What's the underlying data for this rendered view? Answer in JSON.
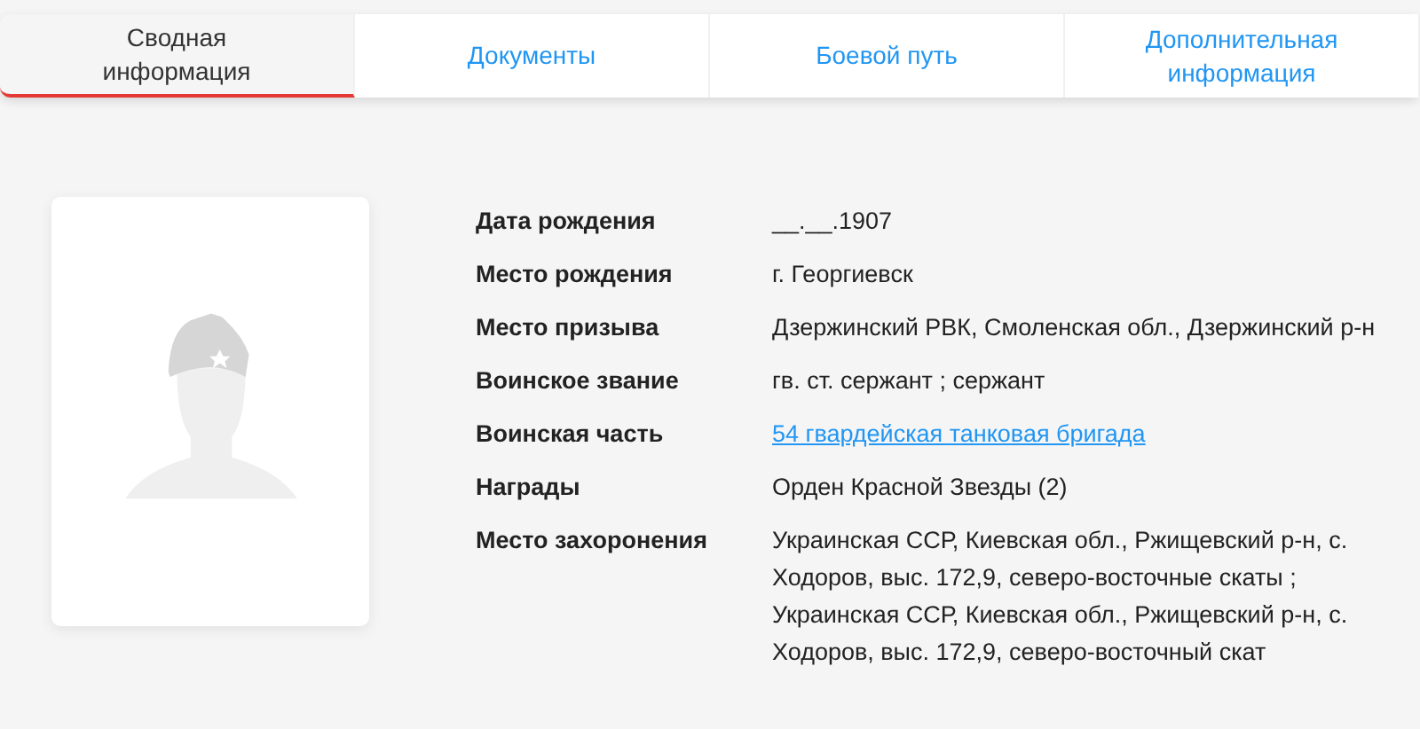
{
  "tabs": [
    {
      "label": "Сводная информация",
      "selected": true
    },
    {
      "label": "Документы",
      "selected": false
    },
    {
      "label": "Боевой путь",
      "selected": false
    },
    {
      "label": "Дополнительная информация",
      "selected": false
    }
  ],
  "details": [
    {
      "label": "Дата рождения",
      "value": "__.__.1907",
      "kind": "text"
    },
    {
      "label": "Место рождения",
      "value": "г. Георгиевск",
      "kind": "text"
    },
    {
      "label": "Место призыва",
      "value": "Дзержинский РВК, Смоленская обл., Дзержинский р-н",
      "kind": "text"
    },
    {
      "label": "Воинское звание",
      "value": "гв. ст. сержант ; сержант",
      "kind": "text"
    },
    {
      "label": "Воинская часть",
      "value": "54 гвардейская танковая бригада",
      "kind": "link"
    },
    {
      "label": "Награды",
      "value": "Орден Красной Звезды (2)",
      "kind": "text"
    },
    {
      "label": "Место захоронения",
      "value": "Украинская ССР, Киевская обл., Ржищевский р-н, с. Ходоров, выс. 172,9, северо-восточные скаты ; Украинская ССР, Киевская обл., Ржищевский р-н, с. Ходоров, выс. 172,9, северо-восточный скат",
      "kind": "text"
    }
  ]
}
